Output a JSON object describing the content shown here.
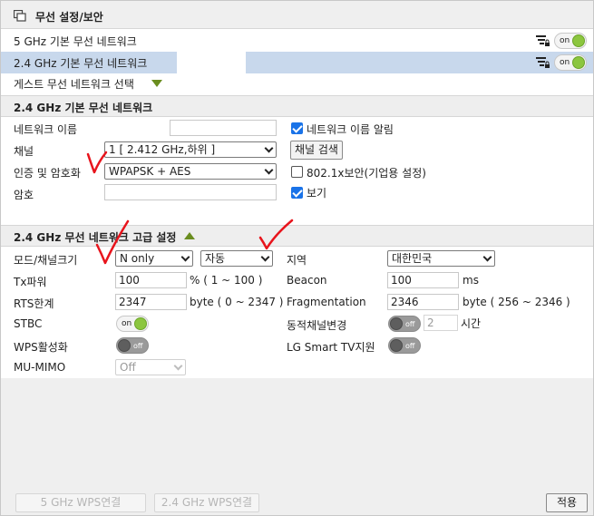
{
  "title": "무선 설정/보안",
  "networks": [
    {
      "label": "5 GHz 기본 무선 네트워크",
      "toggle": "on"
    },
    {
      "label": "2.4 GHz 기본 무선 네트워크",
      "toggle": "on"
    }
  ],
  "guest_label": "게스트 무선 네트워크 선택",
  "basic": {
    "header": "2.4 GHz 기본 무선 네트워크",
    "network_name_label": "네트워크 이름",
    "network_name_value": "",
    "broadcast_label": "네트워크 이름 알림",
    "channel_label": "채널",
    "channel_value": "1 [ 2.412 GHz,하위 ]",
    "channel_search_label": "채널 검색",
    "auth_label": "인증 및 암호화",
    "auth_value": "WPAPSK + AES",
    "dot1x_label": "802.1x보안(기업용 설정)",
    "password_label": "암호",
    "password_value": "",
    "show_label": "보기"
  },
  "advanced": {
    "header": "2.4 GHz 무선 네트워크 고급 설정",
    "mode_label": "모드/채널크기",
    "mode_value": "N only",
    "width_value": "자동",
    "region_label": "지역",
    "region_value": "대한민국",
    "txpower_label": "Tx파워",
    "txpower_value": "100",
    "txpower_unit": "% ( 1 ~ 100 )",
    "beacon_label": "Beacon",
    "beacon_value": "100",
    "beacon_unit": "ms",
    "rts_label": "RTS한계",
    "rts_value": "2347",
    "rts_unit": "byte ( 0 ~ 2347 )",
    "frag_label": "Fragmentation",
    "frag_value": "2346",
    "frag_unit": "byte ( 256 ~ 2346 )",
    "stbc_label": "STBC",
    "stbc_toggle": "on",
    "dyn_channel_label": "동적채널변경",
    "dyn_channel_toggle": "off",
    "dyn_channel_value": "2",
    "dyn_channel_unit": "시간",
    "wps_label": "WPS활성화",
    "wps_toggle": "off",
    "lg_tv_label": "LG Smart TV지원",
    "lg_tv_toggle": "off",
    "mumimo_label": "MU-MIMO",
    "mumimo_value": "Off"
  },
  "footer": {
    "wps5_label": "5 GHz WPS연결",
    "wps24_label": "2.4 GHz WPS연결",
    "apply_label": "적용"
  },
  "colors": {
    "accent_green": "#8cc63f",
    "selected_row": "#c8d8ec",
    "checkbox_blue": "#1a73e8",
    "annotation_red": "#e8141c"
  }
}
